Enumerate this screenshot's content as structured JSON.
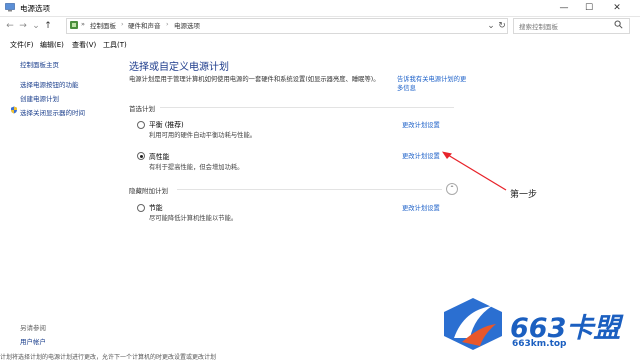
{
  "window": {
    "title": "电源选项"
  },
  "titlebar": {
    "minimize_glyph": "—",
    "maximize_glyph": "☐",
    "close_glyph": "✕"
  },
  "nav": {
    "back": "←",
    "forward": "→",
    "recent": "⌄",
    "up": "↑",
    "dropdown": "⌄",
    "refresh": "↻"
  },
  "breadcrumb": {
    "root": "»",
    "items": [
      "控制面板",
      "硬件和声音",
      "电源选项"
    ]
  },
  "search": {
    "placeholder": "搜索控制面板"
  },
  "menu": {
    "items": [
      "文件(F)",
      "编辑(E)",
      "查看(V)",
      "工具(T)"
    ]
  },
  "sidebar": {
    "home": "控制面板主页",
    "items": [
      "选择电源按钮的功能",
      "创建电源计划",
      "选择关闭显示器的时间"
    ],
    "see_also": "另请参阅",
    "user_accounts": "用户帐户"
  },
  "main": {
    "heading": "选择或自定义电源计划",
    "description": "电源计划是用于管理计算机如何使用电源的一套硬件和系统设置(如显示器亮度、睡眠等)。",
    "description_link": "告诉我有关电源计划的更多信息",
    "preferred_section": "首选计划",
    "hidden_section": "隐藏附加计划",
    "plans": [
      {
        "name": "平衡 (推荐)",
        "desc": "利用可用的硬件自动平衡功耗与性能。",
        "link": "更改计划设置",
        "selected": false
      },
      {
        "name": "高性能",
        "desc": "有利于提高性能，但会增加功耗。",
        "link": "更改计划设置",
        "selected": true
      },
      {
        "name": "节能",
        "desc": "尽可能降低计算机性能以节能。",
        "link": "更改计划设置",
        "selected": false
      }
    ],
    "collapse_glyph": "⌃"
  },
  "annotation": {
    "label": "第一步",
    "arrow_color": "#e8232a"
  },
  "watermark": {
    "brand": "663卡盟",
    "url": "663km.top",
    "brand_color": "#1b5fc0",
    "accent_color": "#e8572a"
  },
  "status_text": "计划将选择计划的电源计划进行更改，允许下一个计算机的时更改设置或更改计划"
}
